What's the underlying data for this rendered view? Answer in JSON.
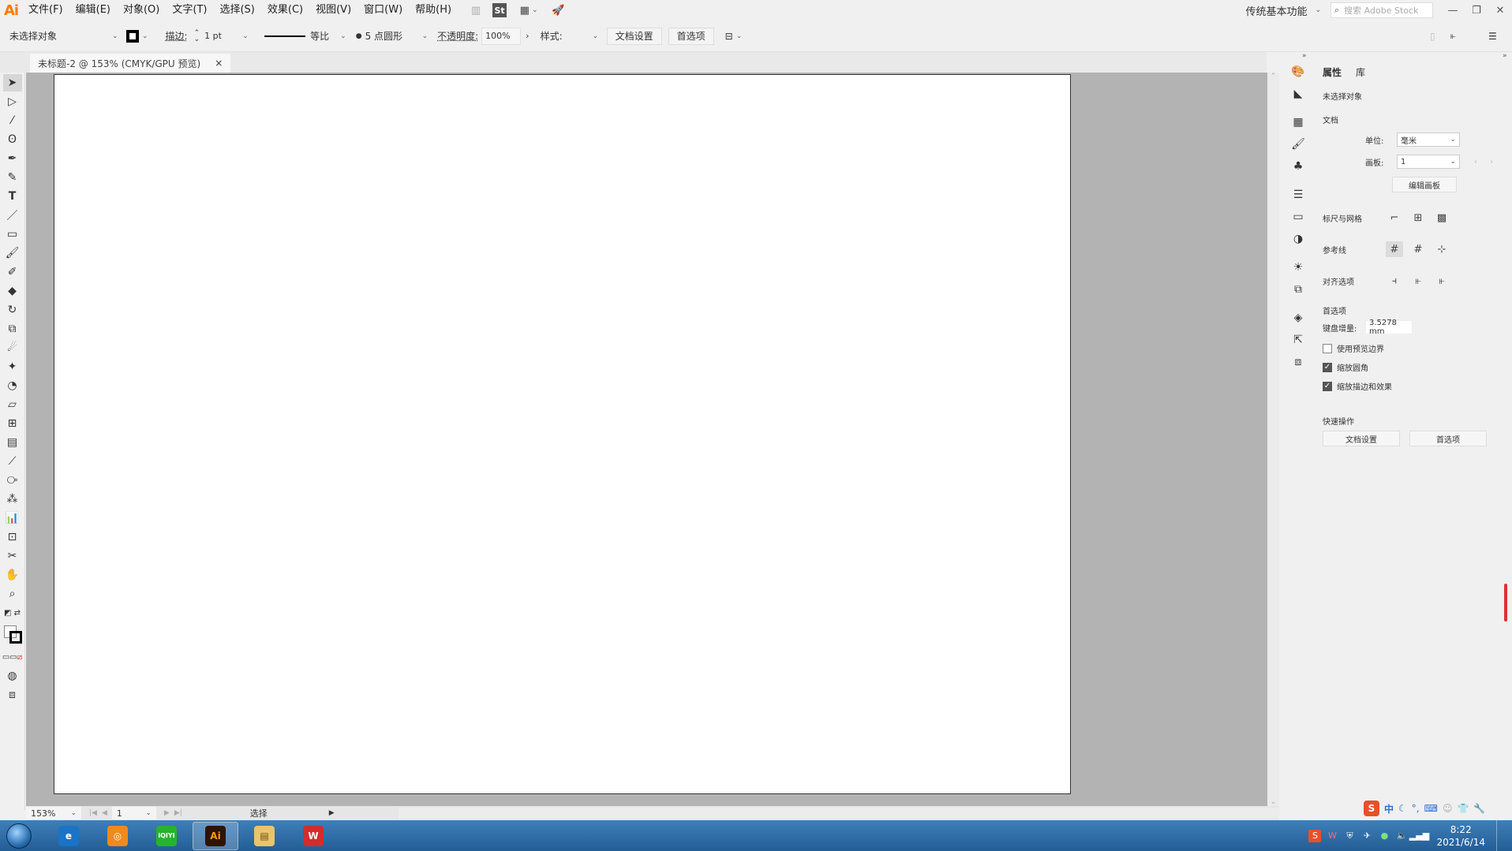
{
  "app": {
    "logo": "Ai",
    "menus": [
      "文件(F)",
      "编辑(E)",
      "对象(O)",
      "文字(T)",
      "选择(S)",
      "效果(C)",
      "视图(V)",
      "窗口(W)",
      "帮助(H)"
    ],
    "st_label": "St",
    "workspace": "传统基本功能",
    "stock_placeholder": "搜索 Adobe Stock"
  },
  "control": {
    "selection": "未选择对象",
    "stroke_label": "描边:",
    "stroke_value": "1 pt",
    "profile": "等比",
    "brush": "5 点圆形",
    "opacity_label": "不透明度:",
    "opacity_value": "100%",
    "style_label": "样式:",
    "doc_setup": "文档设置",
    "prefs": "首选项"
  },
  "tab": {
    "title": "未标题-2 @ 153% (CMYK/GPU 预览)",
    "close": "×"
  },
  "status": {
    "zoom": "153%",
    "artboard": "1",
    "tool": "选择"
  },
  "props": {
    "tab_props": "属性",
    "tab_lib": "库",
    "no_selection": "未选择对象",
    "doc_section": "文档",
    "unit_label": "单位:",
    "unit_value": "毫米",
    "artboard_label": "画板:",
    "artboard_value": "1",
    "edit_artboard": "编辑画板",
    "rulers_grid": "标尺与网格",
    "guides": "参考线",
    "align_options": "对齐选项",
    "preferences": "首选项",
    "keyboard_inc_label": "键盘增量:",
    "keyboard_inc_value": "3.5278 mm",
    "cb_preview_bounds": "使用预览边界",
    "cb_scale_corners": "缩放圆角",
    "cb_scale_strokes": "缩放描边和效果",
    "quick_actions": "快速操作",
    "qa_doc_setup": "文档设置",
    "qa_prefs": "首选项"
  },
  "taskbar": {
    "apps": [
      {
        "label": "e",
        "bg": "#1a73c7",
        "fg": "#ffffff"
      },
      {
        "label": "◎",
        "bg": "#f08a1c",
        "fg": "#ffffff"
      },
      {
        "label": "iQIYI",
        "bg": "#26b42b",
        "fg": "#ffffff"
      },
      {
        "label": "Ai",
        "bg": "#2d1400",
        "fg": "#ff9a00"
      },
      {
        "label": "▤",
        "bg": "#e9c46a",
        "fg": "#6a4d12"
      },
      {
        "label": "W",
        "bg": "#d22d2d",
        "fg": "#ffffff"
      }
    ],
    "ime_lang": "中",
    "time": "8:22",
    "date": "2021/6/14"
  }
}
